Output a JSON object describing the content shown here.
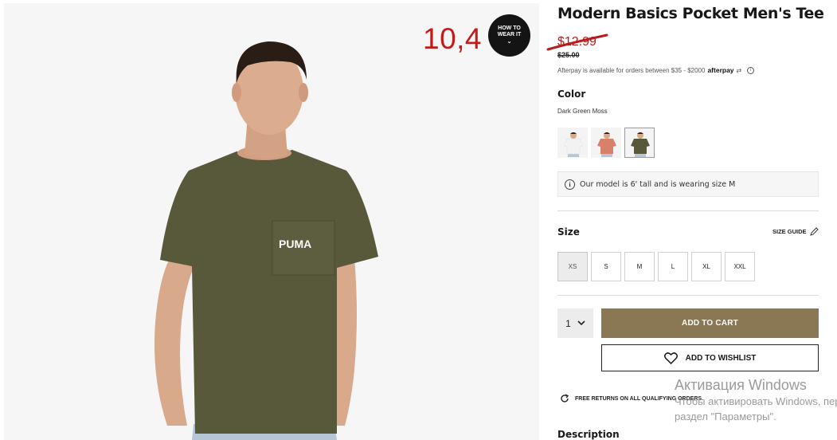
{
  "image": {
    "overlay_price": "10,4",
    "how_to_wear": {
      "line1": "HOW TO",
      "line2": "WEAR IT",
      "chevron": "⌄"
    },
    "shirt_logo": "PUMA",
    "shirt_color": "#58583b"
  },
  "product": {
    "title": "Modern Basics Pocket Men's Tee",
    "old_price": "$12.99",
    "price": "$25.00",
    "afterpay": {
      "text": "Afterpay is available for orders between $35 - $2000",
      "logo": "afterpay",
      "logo_mark": "⇄",
      "info": "i"
    },
    "color": {
      "label": "Color",
      "value": "Dark Green Moss",
      "swatches": [
        {
          "name": "White",
          "color": "#f2f2f2"
        },
        {
          "name": "Coral",
          "color": "#d9806a"
        },
        {
          "name": "Dark Green Moss",
          "color": "#58583b",
          "selected": true
        }
      ]
    },
    "model_note": {
      "icon": "i",
      "text": "Our model is 6' tall and is wearing size M"
    },
    "size": {
      "label": "Size",
      "guide": "SIZE GUIDE",
      "options": [
        "XS",
        "S",
        "M",
        "L",
        "XL",
        "XXL"
      ],
      "selected": "XS"
    },
    "quantity": "1",
    "add_to_cart": "ADD TO CART",
    "add_to_wishlist": "ADD TO WISHLIST",
    "returns": "FREE RETURNS ON ALL QUALIFYING ORDERS.",
    "description_label": "Description"
  },
  "colors": {
    "sale_red": "#b81d1d",
    "overlay_red": "#c41a1a",
    "cart_button": "#8a7753"
  },
  "watermark": {
    "line1": "Активация Windows",
    "line2": "Чтобы активировать Windows, перейдите в",
    "line3": "раздел \"Параметры\"."
  }
}
